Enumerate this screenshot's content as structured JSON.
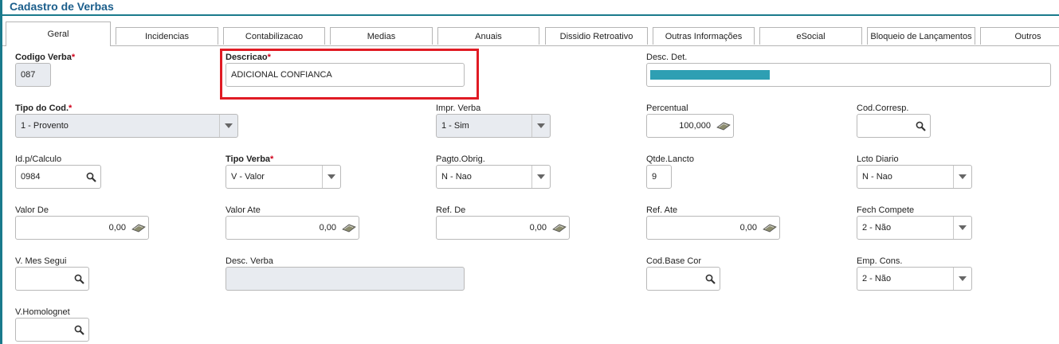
{
  "title": "Cadastro de Verbas",
  "tabs": [
    "Geral",
    "Incidencias",
    "Contabilizacao",
    "Medias",
    "Anuais",
    "Dissidio Retroativo",
    "Outras Informações",
    "eSocial",
    "Bloqueio de Lançamentos",
    "Outros"
  ],
  "fields": {
    "codigo_verba": {
      "label": "Codigo Verba",
      "value": "087"
    },
    "descricao": {
      "label": "Descricao",
      "value": "ADICIONAL CONFIANCA"
    },
    "desc_det": {
      "label": "Desc. Det.",
      "value": ""
    },
    "tipo_cod": {
      "label": "Tipo do Cod.",
      "value": "1 - Provento"
    },
    "impr_verba": {
      "label": "Impr. Verba",
      "value": "1 - Sim"
    },
    "percentual": {
      "label": "Percentual",
      "value": "100,000"
    },
    "cod_corresp": {
      "label": "Cod.Corresp.",
      "value": ""
    },
    "id_calculo": {
      "label": "Id.p/Calculo",
      "value": "0984"
    },
    "tipo_verba": {
      "label": "Tipo Verba",
      "value": "V - Valor"
    },
    "pagto_obrig": {
      "label": "Pagto.Obrig.",
      "value": "N - Nao"
    },
    "qtde_lancto": {
      "label": "Qtde.Lancto",
      "value": "9"
    },
    "lcto_diario": {
      "label": "Lcto Diario",
      "value": "N - Nao"
    },
    "valor_de": {
      "label": "Valor De",
      "value": "0,00"
    },
    "valor_ate": {
      "label": "Valor Ate",
      "value": "0,00"
    },
    "ref_de": {
      "label": "Ref. De",
      "value": "0,00"
    },
    "ref_ate": {
      "label": "Ref. Ate",
      "value": "0,00"
    },
    "fech_compete": {
      "label": "Fech Compete",
      "value": "2 - Não"
    },
    "v_mes_segui": {
      "label": "V. Mes Segui",
      "value": ""
    },
    "desc_verba": {
      "label": "Desc. Verba",
      "value": ""
    },
    "cod_base_cor": {
      "label": "Cod.Base Cor",
      "value": ""
    },
    "emp_cons": {
      "label": "Emp. Cons.",
      "value": "2 - Não"
    },
    "v_homolognet": {
      "label": "V.Homolognet",
      "value": ""
    }
  },
  "required_mark": "*",
  "colors": {
    "accent": "#1a7a8c",
    "title": "#1b5e8c",
    "required": "#d0021b",
    "highlight": "#e01b24",
    "desc_det_bar": "#2e9fb3"
  },
  "icons": {
    "search": "search-icon",
    "calculator": "calculator-icon",
    "dropdown": "chevron-down-icon"
  }
}
